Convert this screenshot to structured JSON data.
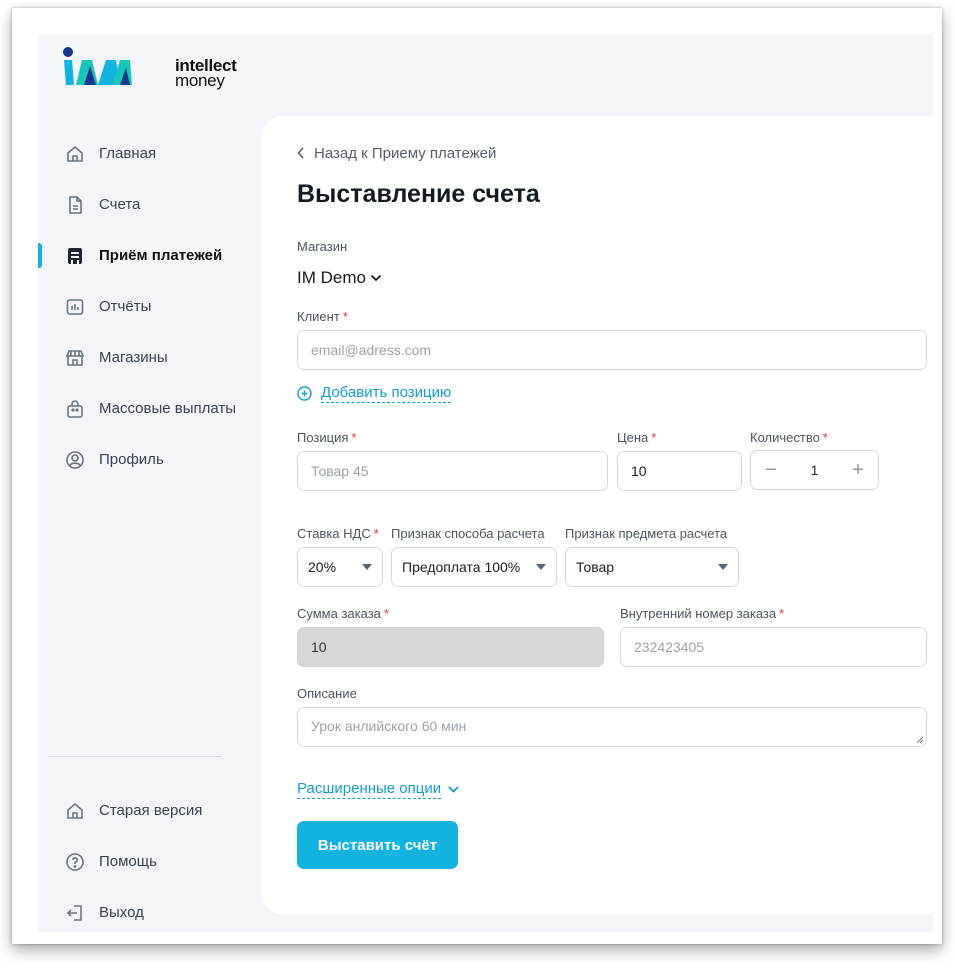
{
  "brand": {
    "line1": "intellect",
    "line2": "money"
  },
  "nav": {
    "items": [
      {
        "label": "Главная",
        "icon": "home-icon"
      },
      {
        "label": "Счета",
        "icon": "document-icon"
      },
      {
        "label": "Приём платежей",
        "icon": "terminal-icon",
        "active": true
      },
      {
        "label": "Отчёты",
        "icon": "report-icon"
      },
      {
        "label": "Магазины",
        "icon": "store-icon"
      },
      {
        "label": "Массовые выплаты",
        "icon": "bag-icon"
      },
      {
        "label": "Профиль",
        "icon": "profile-icon"
      }
    ],
    "bottom": [
      {
        "label": "Старая версия",
        "icon": "home-icon"
      },
      {
        "label": "Помощь",
        "icon": "help-icon"
      },
      {
        "label": "Выход",
        "icon": "logout-icon"
      }
    ]
  },
  "page": {
    "back_label": "Назад к Приему платежей",
    "title": "Выставление счета"
  },
  "form": {
    "store_label": "Магазин",
    "store_value": "IM Demo",
    "client_label": "Клиент",
    "client_placeholder": "email@adress.com",
    "add_position": "Добавить позицию",
    "position_label": "Позиция",
    "position_placeholder": "Товар 45",
    "price_label": "Цена",
    "price_value": "10",
    "qty_label": "Количество",
    "qty_value": "1",
    "qty_minus": "−",
    "qty_plus": "+",
    "vat_label": "Ставка НДС",
    "vat_value": "20%",
    "payment_method_label": "Признак способа расчета",
    "payment_method_value": "Предоплата 100%",
    "subject_label": "Признак предмета расчета",
    "subject_value": "Товар",
    "sum_label": "Сумма заказа",
    "sum_value": "10",
    "order_number_label": "Внутренний номер заказа",
    "order_number_placeholder": "232423405",
    "description_label": "Описание",
    "description_placeholder": "Урок анлийского 60 мин",
    "advanced_options": "Расширенные опции",
    "submit_label": "Выставить счёт",
    "required_mark": "*"
  },
  "colors": {
    "accent": "#13b3e0",
    "link": "#159ec8",
    "required": "#e3342f",
    "background": "#f3f5f8"
  }
}
